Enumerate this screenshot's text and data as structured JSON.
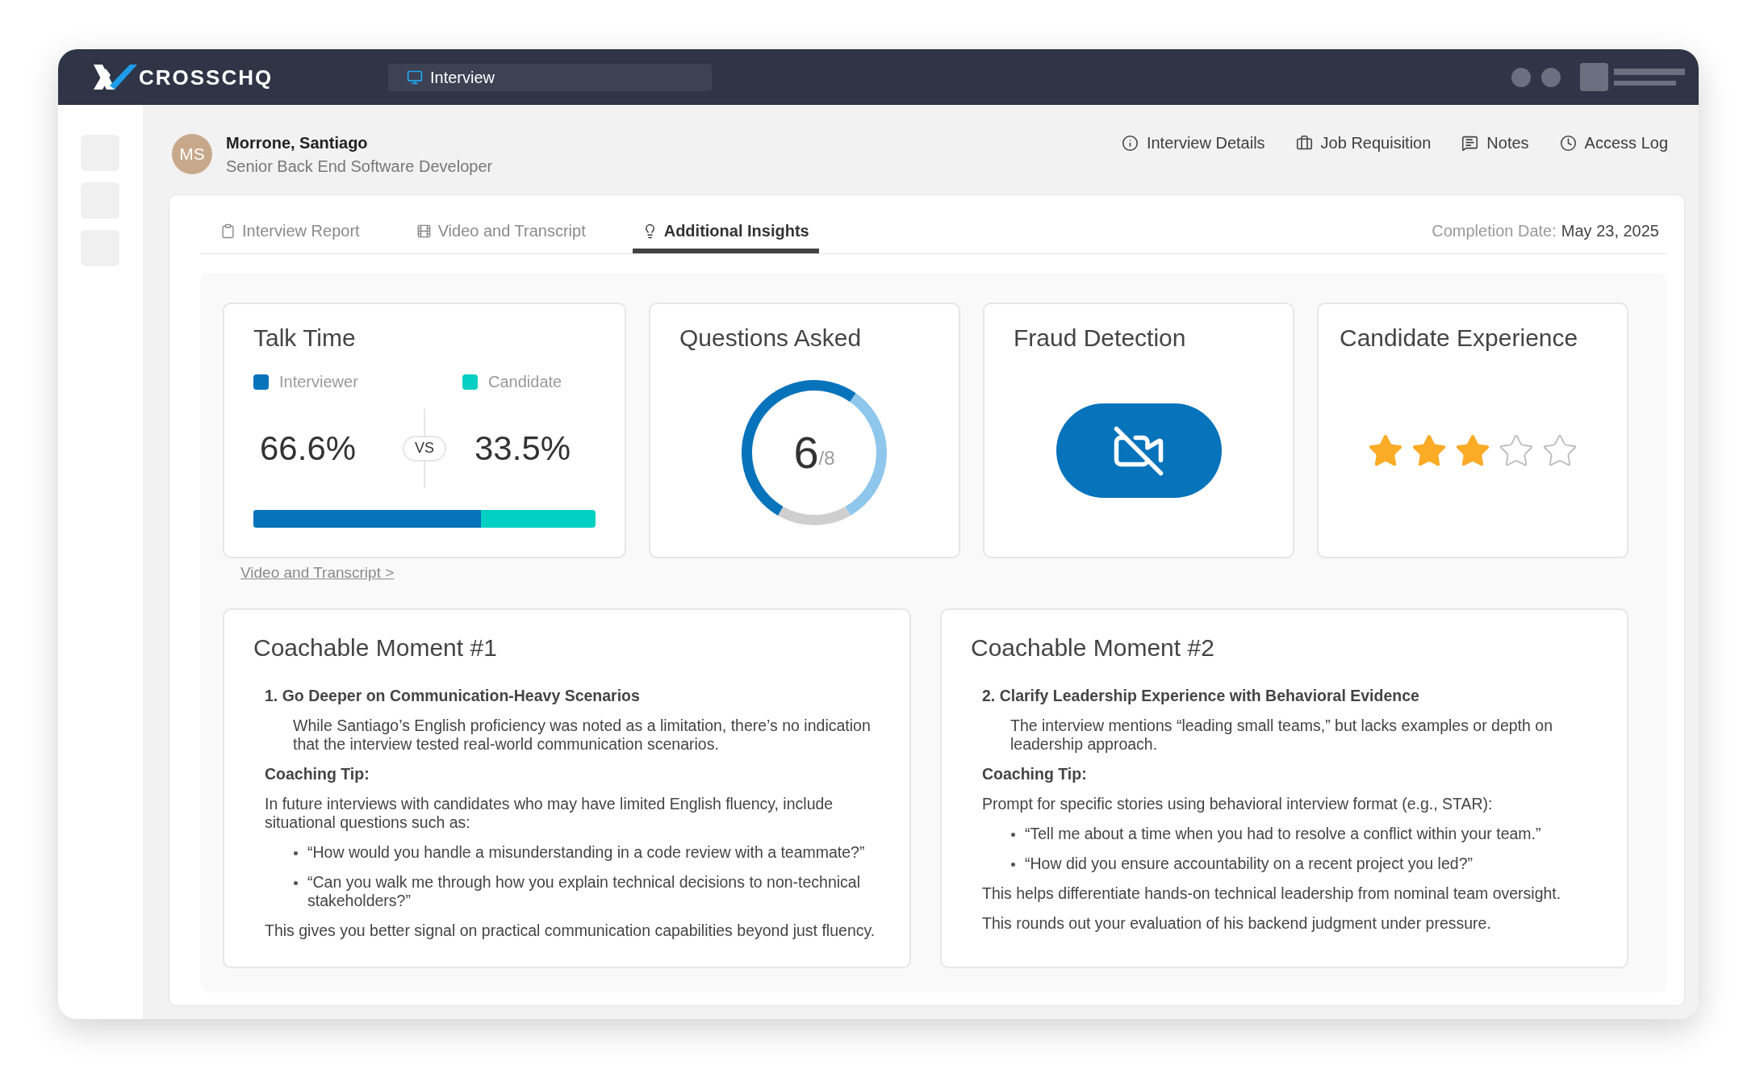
{
  "app_bar": {
    "logo_text": "CROSSCHQ",
    "section_tab": {
      "label": "Interview"
    }
  },
  "candidate": {
    "initials": "MS",
    "name": "Morrone, Santiago",
    "role": "Senior Back End Software Developer"
  },
  "header_links": [
    {
      "label": "Interview Details"
    },
    {
      "label": "Job Requisition"
    },
    {
      "label": "Notes"
    },
    {
      "label": "Access Log"
    }
  ],
  "tabs": [
    {
      "label": "Interview Report",
      "selected": false
    },
    {
      "label": "Video and Transcript",
      "selected": false
    },
    {
      "label": "Additional Insights",
      "selected": true
    }
  ],
  "completion": {
    "label": "Completion Date:",
    "value": "May 23, 2025"
  },
  "talk_time": {
    "title": "Talk Time",
    "legend": [
      {
        "label": "Interviewer",
        "color": "#0673bb"
      },
      {
        "label": "Candidate",
        "color": "#00cfc3"
      }
    ],
    "interviewer_share": "66.6%",
    "vs": "VS",
    "candidate_share": "33.5%",
    "level": 0.666,
    "link": "Video and Transcript >"
  },
  "questions_asked": {
    "title": "Questions Asked",
    "asked": "6",
    "total": "/8"
  },
  "fraud_detection": {
    "title": "Fraud Detection"
  },
  "candidate_experience": {
    "title": "Candidate Experience",
    "stars": 3
  },
  "coachable_moments": [
    {
      "title": "Coachable Moment #1",
      "heading": "1. Go Deeper on Communication-Heavy Scenarios",
      "description": "While Santiago’s English proficiency was noted as a limitation, there’s no indication that the interview tested real-world communication scenarios.",
      "tip_label": "Coaching Tip:",
      "tip_intro": "In future interviews with candidates who may have limited English fluency, include situational questions such as:",
      "examples": [
        "“How would you handle a misunderstanding in a code review with a teammate?”",
        "“Can you walk me through how you explain technical decisions to non-technical stakeholders?”"
      ],
      "closing": [
        "This gives you better signal on practical communication capabilities beyond just fluency."
      ]
    },
    {
      "title": "Coachable Moment #2",
      "heading": "2. Clarify Leadership Experience with Behavioral Evidence",
      "description": "The interview mentions “leading small teams,” but lacks examples or depth on leadership approach.",
      "tip_label": "Coaching Tip:",
      "tip_intro": "Prompt for specific stories using behavioral interview format (e.g., STAR):",
      "examples": [
        "“Tell me about a time when you had to resolve a conflict within your team.”",
        "“How did you ensure accountability on a recent project you led?”"
      ],
      "closing": [
        "This helps differentiate hands-on technical leadership from nominal team oversight.",
        "This rounds out your evaluation of his backend judgment under pressure."
      ]
    }
  ]
}
